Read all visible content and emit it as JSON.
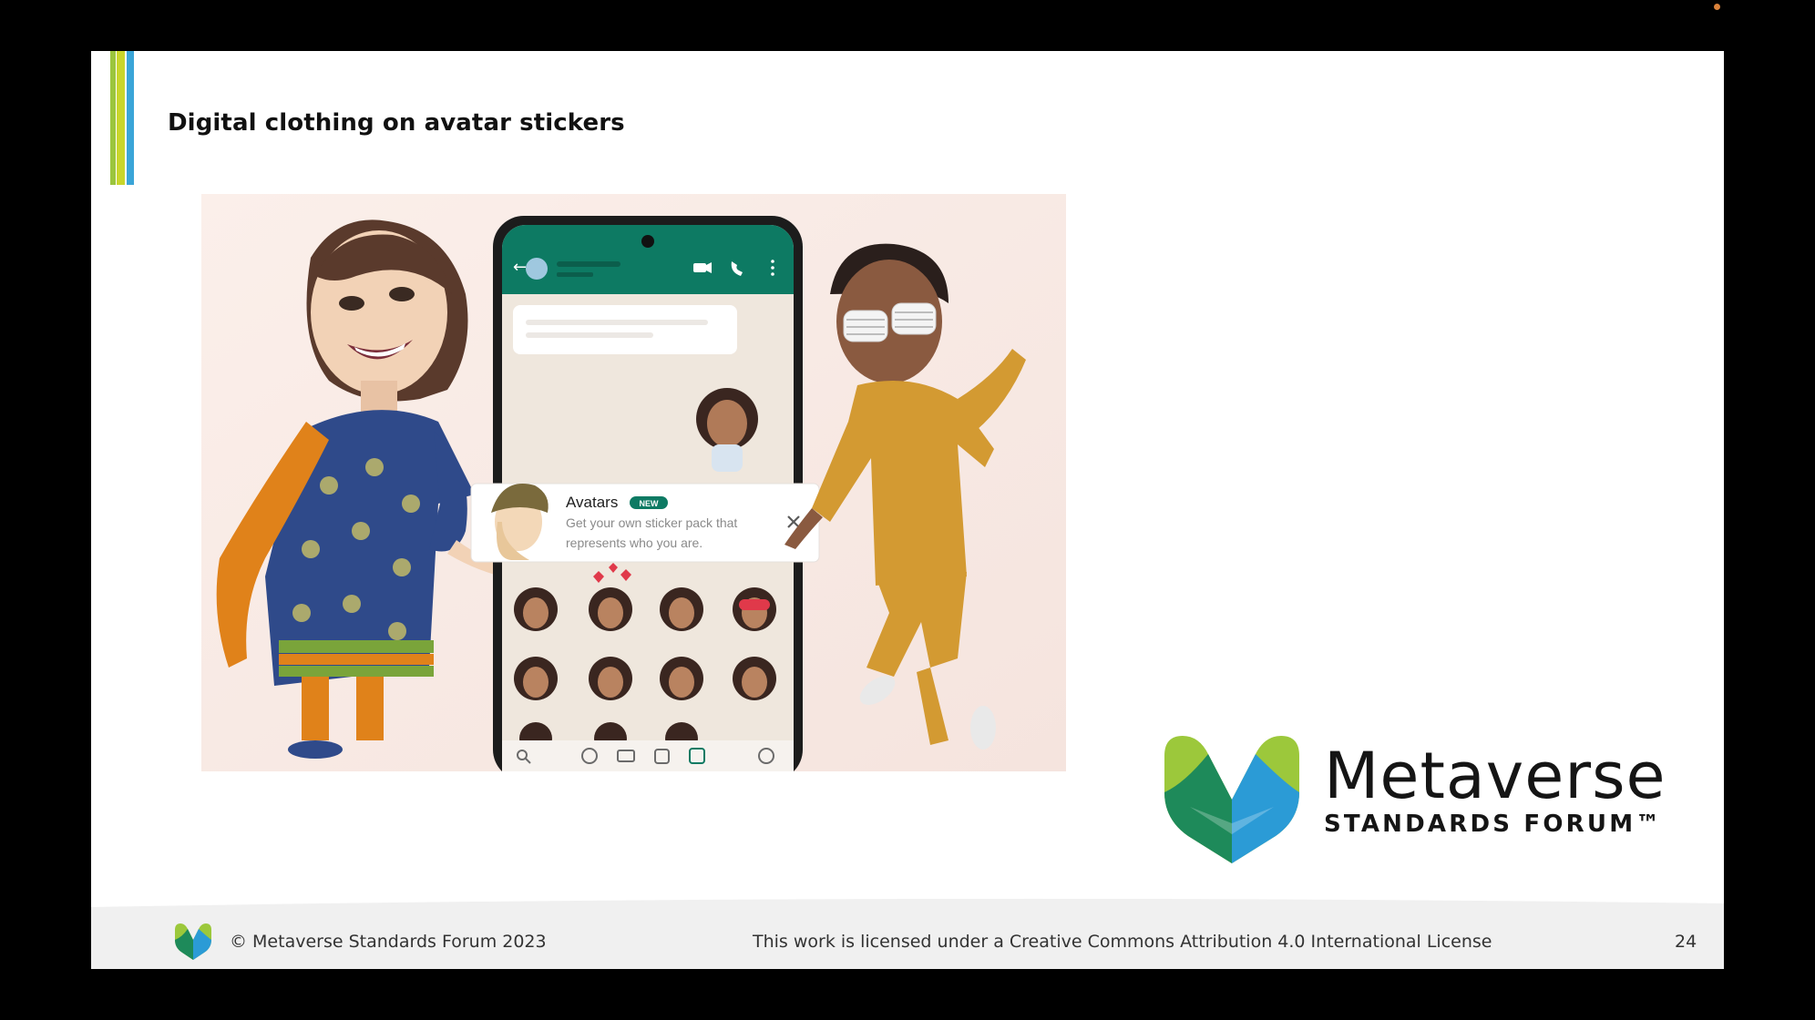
{
  "slide": {
    "title": "Digital clothing on avatar stickers",
    "accent_colors": [
      "#9bc53d",
      "#c9d62b",
      "#3aa5d8"
    ]
  },
  "phone_popup": {
    "title": "Avatars",
    "badge": "NEW",
    "line1": "Get your own sticker pack that",
    "line2": "represents who you are."
  },
  "brand": {
    "name": "Metaverse",
    "sub": "STANDARDS FORUM™",
    "colors": [
      "#2b9bd6",
      "#9cc83b",
      "#1e8a5a"
    ]
  },
  "footer": {
    "copyright": "© Metaverse Standards Forum 2023",
    "license": "This work is licensed under a Creative Commons Attribution 4.0 International License",
    "page_number": "24"
  }
}
